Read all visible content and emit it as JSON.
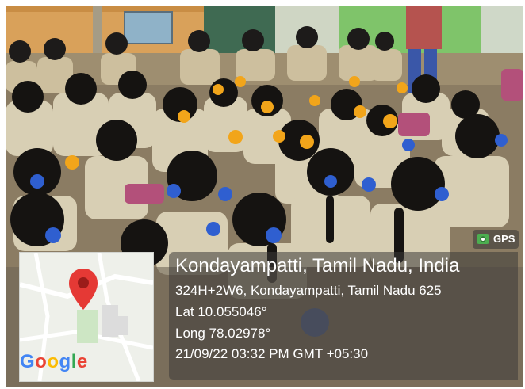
{
  "overlay": {
    "place_title": "Kondayampatti, Tamil Nadu, India",
    "address": "324H+2W6, Kondayampatti, Tamil Nadu 625",
    "latitude": "Lat 10.055046°",
    "longitude": "Long 78.02978°",
    "timestamp": "21/09/22 03:32 PM GMT +05:30",
    "gps_badge": "GPS"
  },
  "map": {
    "logo_text": "Google",
    "pin_icon": "map-pin-icon",
    "pin_color": "#e53935"
  },
  "photo": {
    "description_icon": "photo",
    "wall_color": "#d9a15a",
    "uniform_color": "#d8cfb4",
    "ribbon_color": "#2f5fd0",
    "flower_color": "#f2a51a"
  }
}
